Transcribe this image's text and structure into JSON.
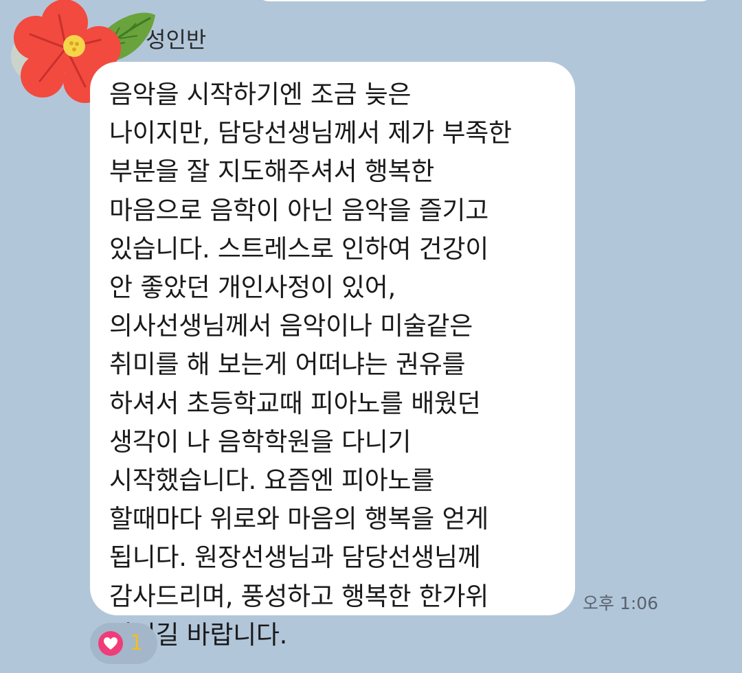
{
  "sender": {
    "name": "성인반"
  },
  "message": {
    "text": "음악을 시작하기엔 조금 늦은\n나이지만, 담당선생님께서 제가 부족한\n부분을 잘 지도해주셔서 행복한\n마음으로 음학이 아닌 음악을 즐기고\n있습니다. 스트레스로 인하여 건강이\n안 좋았던 개인사정이 있어,\n의사선생님께서 음악이나 미술같은\n취미를 해 보는게 어떠냐는 권유를\n하셔서 초등학교때 피아노를 배웠던\n생각이 나 음학학원을 다니기\n시작했습니다. 요즘엔 피아노를\n할때마다 위로와 마음의 행복을 얻게\n됩니다. 원장선생님과 담당선생님께\n감사드리며, 풍성하고 행복한 한가위\n되시길 바랍니다.",
    "time": "오후 1:06"
  },
  "reaction": {
    "icon": "heart-icon",
    "count": "1",
    "icon_color": "#f03c78",
    "count_color": "#f0c020"
  },
  "avatar": {
    "icon": "hibiscus-flower-icon",
    "petal_color": "#f24a3f",
    "leaf_color": "#6aa33c"
  },
  "colors": {
    "background": "#b2c6da",
    "bubble": "#ffffff"
  }
}
